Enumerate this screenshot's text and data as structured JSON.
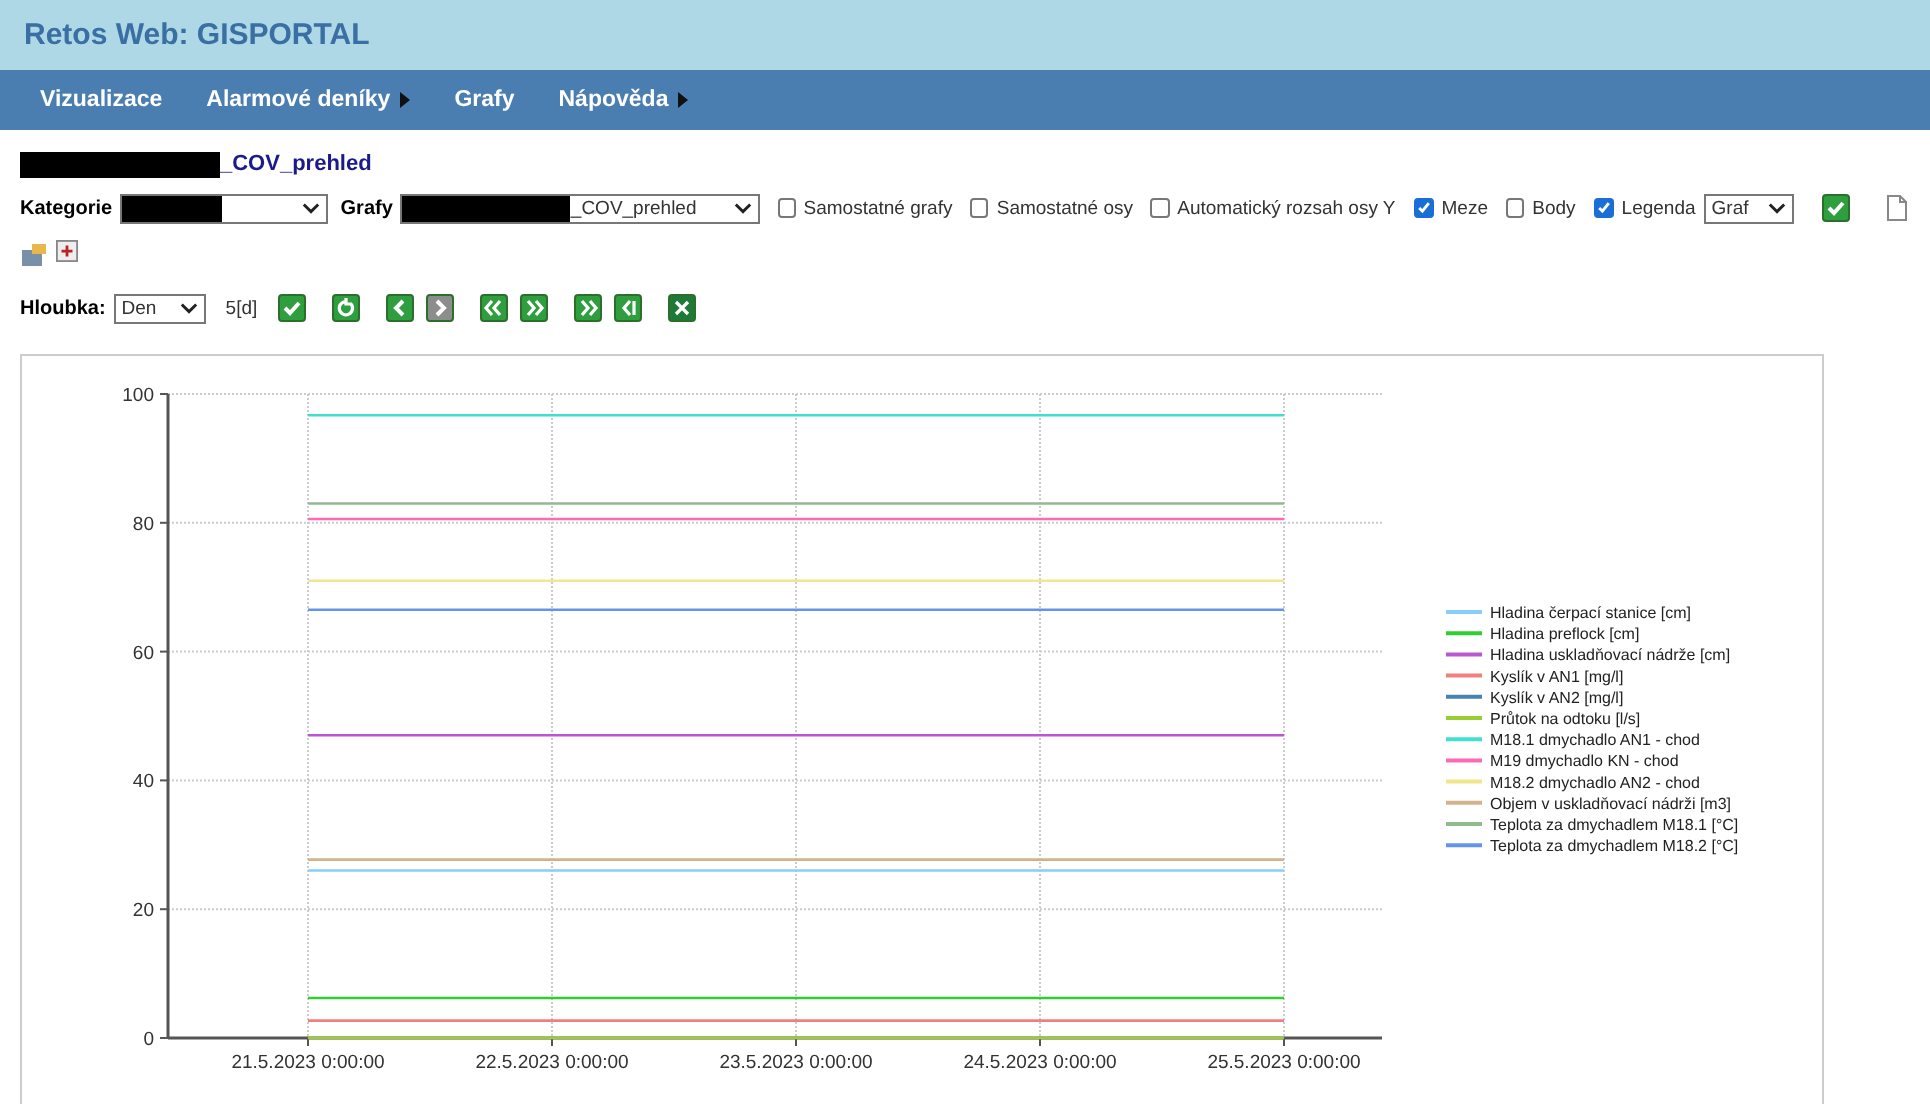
{
  "window": {
    "title": "Retos Web: GISPORTAL"
  },
  "menu": [
    {
      "label": "Vizualizace",
      "submenu": false
    },
    {
      "label": "Alarmové deníky",
      "submenu": true
    },
    {
      "label": "Grafy",
      "submenu": false
    },
    {
      "label": "Nápověda",
      "submenu": true
    }
  ],
  "page_title": "_COV_prehled",
  "filters": {
    "category_label": "Kategorie",
    "graphs_label": "Grafy",
    "graphs_value": "_COV_prehled"
  },
  "options": [
    {
      "label": "Samostatné grafy",
      "checked": false
    },
    {
      "label": "Samostatné osy",
      "checked": false
    },
    {
      "label": "Automatický rozsah osy Y",
      "checked": false
    },
    {
      "label": "Meze",
      "checked": true
    },
    {
      "label": "Body",
      "checked": false
    },
    {
      "label": "Legenda",
      "checked": true
    }
  ],
  "view_select": "Graf",
  "depth": {
    "label": "Hloubka:",
    "value": "Den",
    "span": "5[d]"
  },
  "nav_buttons": [
    {
      "kind": "check"
    },
    {
      "kind": "refresh"
    },
    {
      "kind": "back"
    },
    {
      "kind": "forward-disabled"
    },
    {
      "kind": "double-back"
    },
    {
      "kind": "double-forward"
    },
    {
      "kind": "end-forward"
    },
    {
      "kind": "end-back"
    },
    {
      "kind": "excel"
    }
  ],
  "chart": {
    "chart_data": {
      "type": "line",
      "categories": [
        "21.5.2023 0:00:00",
        "22.5.2023 0:00:00",
        "23.5.2023 0:00:00",
        "24.5.2023 0:00:00",
        "25.5.2023 0:00:00"
      ],
      "ylim": [
        0,
        100
      ],
      "yticks": [
        0,
        20,
        40,
        60,
        80,
        100
      ],
      "grid": true,
      "legend": "right",
      "series": [
        {
          "name": "Hladina čerpací stanice [cm]",
          "color": "#87cefa",
          "values": [
            26,
            26,
            26,
            26,
            26
          ]
        },
        {
          "name": "Hladina preflock [cm]",
          "color": "#32cd32",
          "values": [
            6.2,
            6.2,
            6.2,
            6.2,
            6.2
          ]
        },
        {
          "name": "Hladina uskladňovací nádrže [cm]",
          "color": "#ba55d3",
          "values": [
            47,
            47,
            47,
            47,
            47
          ]
        },
        {
          "name": "Kyslík v AN1 [mg/l]",
          "color": "#f08080",
          "values": [
            2.7,
            2.7,
            2.7,
            2.7,
            2.7
          ]
        },
        {
          "name": "Kyslík v AN2 [mg/l]",
          "color": "#4682b4",
          "values": [
            null,
            null,
            null,
            null,
            null
          ]
        },
        {
          "name": "Průtok na odtoku [l/s]",
          "color": "#9acd32",
          "values": [
            0,
            0,
            0,
            0,
            0
          ]
        },
        {
          "name": "M18.1 dmychadlo AN1 - chod",
          "color": "#40e0d0",
          "values": [
            96.7,
            96.7,
            96.7,
            96.7,
            96.7
          ]
        },
        {
          "name": "M19 dmychadlo KN - chod",
          "color": "#ff69b4",
          "values": [
            80.6,
            80.6,
            80.6,
            80.6,
            80.6
          ]
        },
        {
          "name": "M18.2 dmychadlo AN2 - chod",
          "color": "#f0e68c",
          "values": [
            71,
            71,
            71,
            71,
            71
          ]
        },
        {
          "name": "Objem v uskladňovací nádrži [m3]",
          "color": "#d2b48c",
          "values": [
            27.7,
            27.7,
            27.7,
            27.7,
            27.7
          ]
        },
        {
          "name": "Teplota za dmychadlem M18.1 [°C]",
          "color": "#8fbc8f",
          "values": [
            83,
            83,
            83,
            83,
            83
          ]
        },
        {
          "name": "Teplota za dmychadlem M18.2 [°C]",
          "color": "#6495ed",
          "values": [
            66.5,
            66.5,
            66.5,
            66.5,
            66.5
          ]
        }
      ]
    }
  }
}
